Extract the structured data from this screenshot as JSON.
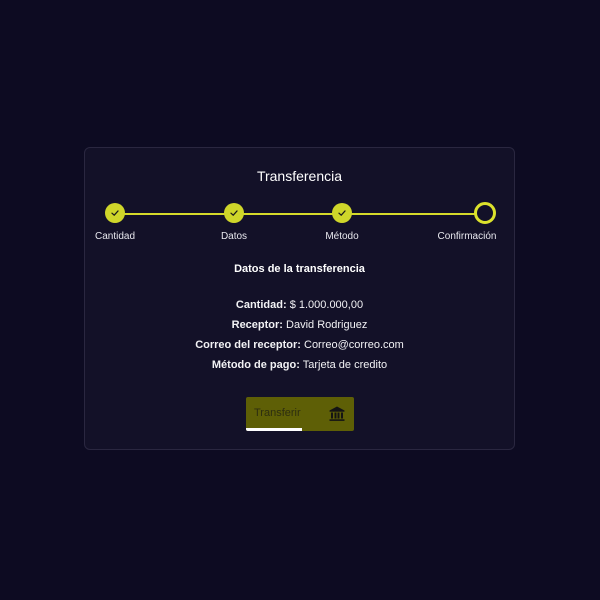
{
  "card": {
    "title": "Transferencia"
  },
  "steps": [
    {
      "label": "Cantidad",
      "state": "done",
      "icon": "check-icon"
    },
    {
      "label": "Datos",
      "state": "done",
      "icon": "check-icon"
    },
    {
      "label": "Método",
      "state": "done",
      "icon": "check-icon"
    },
    {
      "label": "Confirmación",
      "state": "active",
      "icon": "ring-icon"
    }
  ],
  "summary": {
    "title": "Datos de la transferencia",
    "rows": [
      {
        "label": "Cantidad:",
        "value": "$ 1.000.000,00"
      },
      {
        "label": "Receptor:",
        "value": "David Rodriguez"
      },
      {
        "label": "Correo del receptor:",
        "value": "Correo@correo.com"
      },
      {
        "label": "Método de pago:",
        "value": "Tarjeta de credito"
      }
    ]
  },
  "submit": {
    "label": "Transferir",
    "icon": "bank-icon",
    "progress": 0.52
  },
  "colors": {
    "background": "#0d0b22",
    "card": "#131128",
    "accent": "#d5da2a",
    "button": "#5e5f06"
  }
}
